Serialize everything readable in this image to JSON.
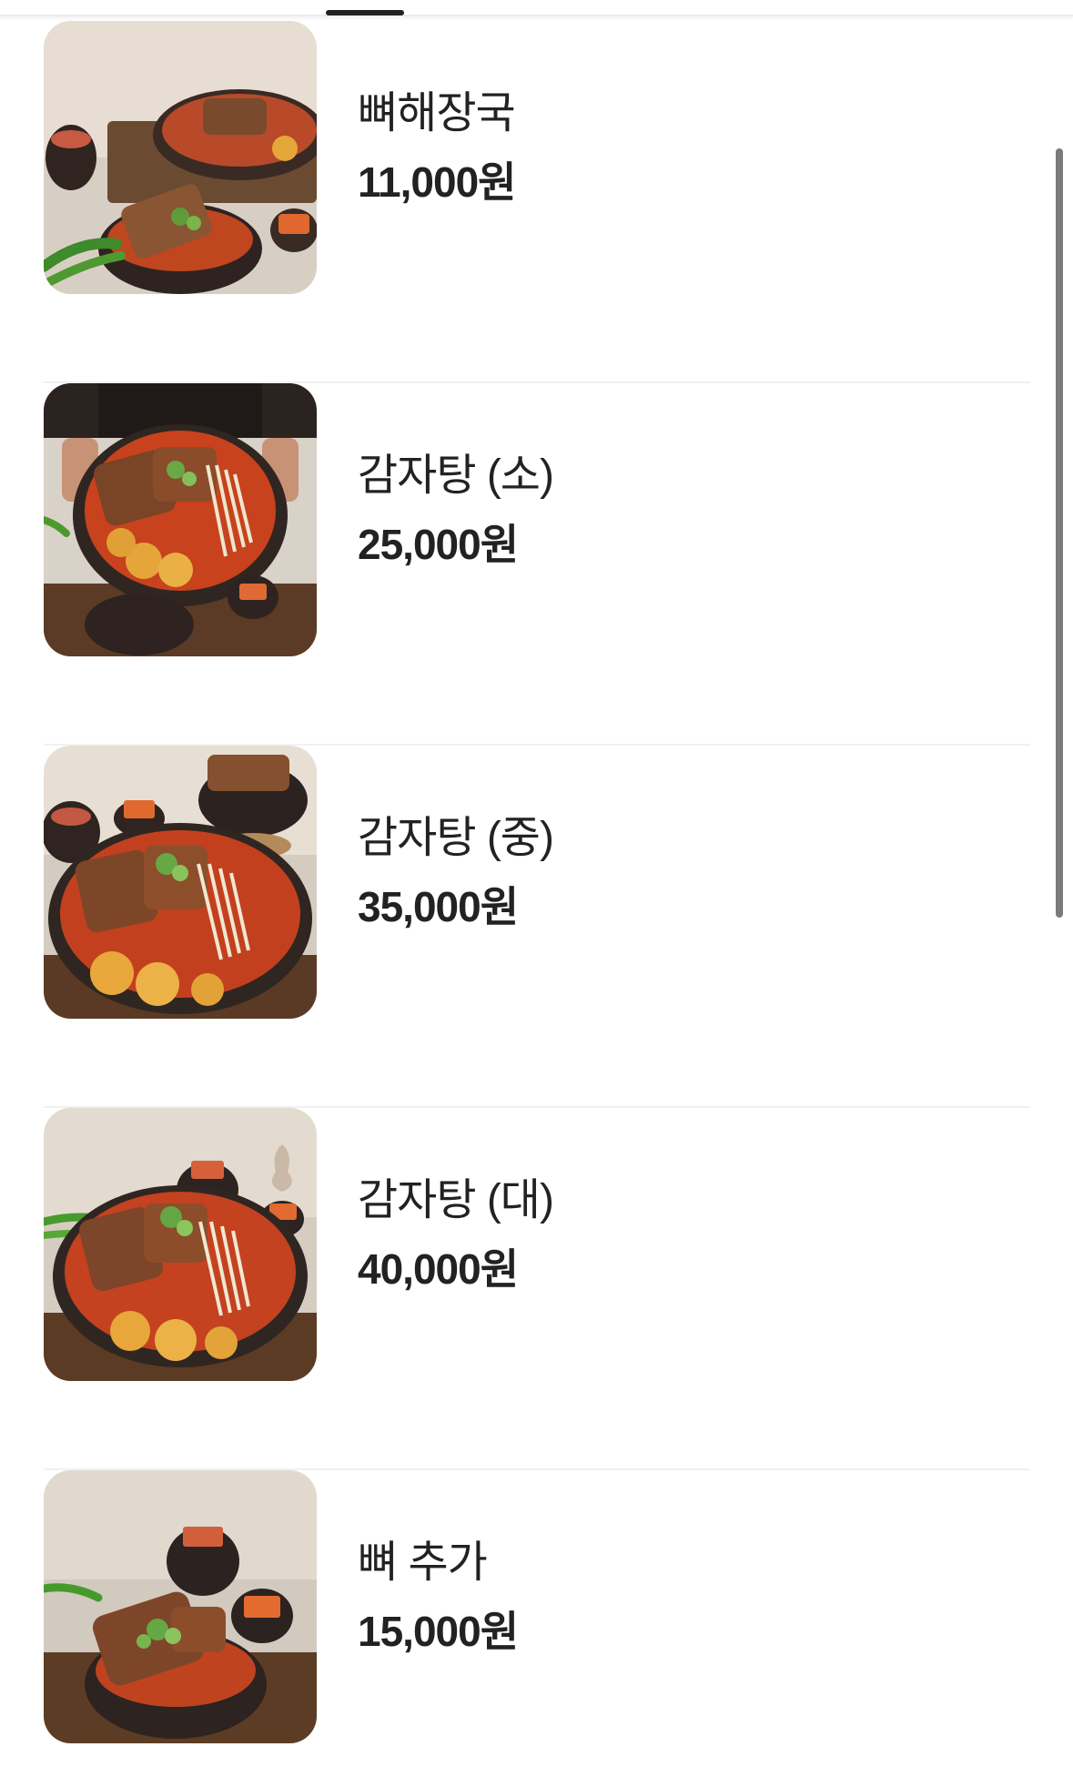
{
  "menu": {
    "items": [
      {
        "name": "뼈해장국",
        "price": "11,000원",
        "image": "bone-hangover-soup-photo"
      },
      {
        "name": "감자탕 (소)",
        "price": "25,000원",
        "image": "gamjatang-small-photo"
      },
      {
        "name": "감자탕 (중)",
        "price": "35,000원",
        "image": "gamjatang-medium-photo"
      },
      {
        "name": "감자탕 (대)",
        "price": "40,000원",
        "image": "gamjatang-large-photo"
      },
      {
        "name": "뼈 추가",
        "price": "15,000원",
        "image": "extra-bone-photo"
      }
    ]
  },
  "colors": {
    "text": "#222222",
    "divider": "#f1f1f1",
    "broth": "#c9401f",
    "pot": "#3a2a24",
    "background_wall": "#e9e2d8"
  }
}
